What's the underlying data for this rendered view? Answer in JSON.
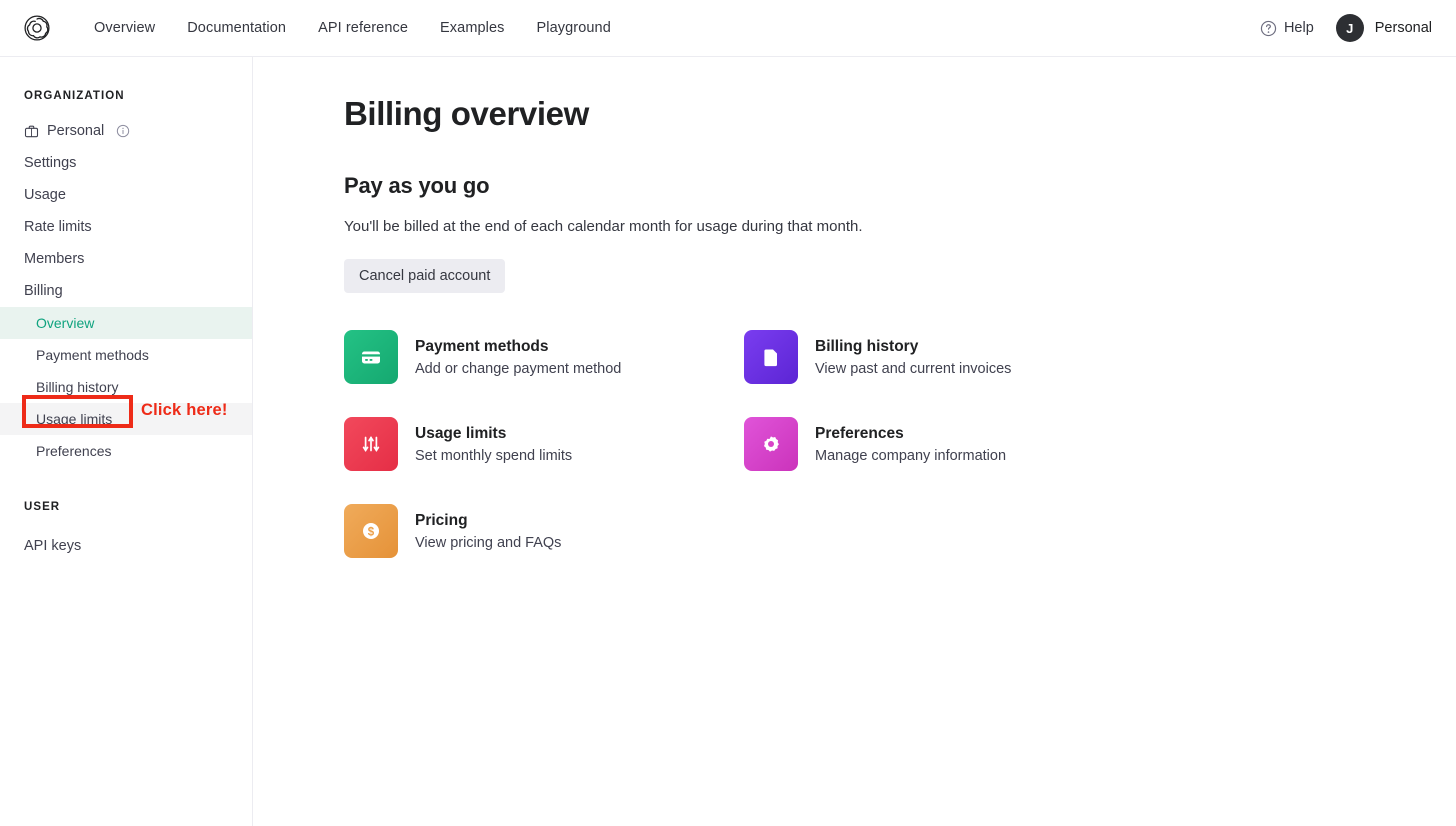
{
  "topnav": {
    "logo_icon": "openai-logo-icon",
    "links": [
      {
        "label": "Overview"
      },
      {
        "label": "Documentation"
      },
      {
        "label": "API reference"
      },
      {
        "label": "Examples"
      },
      {
        "label": "Playground"
      }
    ],
    "help_label": "Help",
    "help_icon": "question-circle-icon",
    "account_initial": "J",
    "account_name": "Personal"
  },
  "sidebar": {
    "org_label": "ORGANIZATION",
    "org_items": [
      {
        "label": "Personal",
        "icon": "briefcase-icon",
        "info_icon": "info-circle-icon",
        "state": "normal"
      },
      {
        "label": "Settings",
        "state": "normal"
      },
      {
        "label": "Usage",
        "state": "normal"
      },
      {
        "label": "Rate limits",
        "state": "normal"
      },
      {
        "label": "Members",
        "state": "normal"
      },
      {
        "label": "Billing",
        "state": "normal"
      }
    ],
    "billing_sub_items": [
      {
        "label": "Overview",
        "state": "active"
      },
      {
        "label": "Payment methods",
        "state": "normal"
      },
      {
        "label": "Billing history",
        "state": "normal"
      },
      {
        "label": "Usage limits",
        "state": "hovered"
      },
      {
        "label": "Preferences",
        "state": "normal"
      }
    ],
    "user_label": "USER",
    "user_items": [
      {
        "label": "API keys",
        "state": "normal"
      }
    ],
    "active_color": "#10a37f",
    "active_bg": "#e9f3ef"
  },
  "annotation": {
    "text": "Click here!",
    "color": "#ee2b18",
    "target": "Usage limits"
  },
  "main": {
    "page_title": "Billing overview",
    "section_title": "Pay as you go",
    "section_desc": "You'll be billed at the end of each calendar month for usage during that month.",
    "cancel_button": "Cancel paid account",
    "cards": [
      {
        "title": "Payment methods",
        "desc": "Add or change payment method",
        "icon": "credit-card-icon",
        "color": "#1bb378"
      },
      {
        "title": "Billing history",
        "desc": "View past and current invoices",
        "icon": "document-icon",
        "color": "#6b31e0"
      },
      {
        "title": "Usage limits",
        "desc": "Set monthly spend limits",
        "icon": "sliders-icon",
        "color": "#ef3b4e"
      },
      {
        "title": "Preferences",
        "desc": "Manage company information",
        "icon": "gear-icon",
        "color": "#d943c8"
      },
      {
        "title": "Pricing",
        "desc": "View pricing and FAQs",
        "icon": "dollar-coin-icon",
        "color": "#eda049"
      }
    ]
  }
}
